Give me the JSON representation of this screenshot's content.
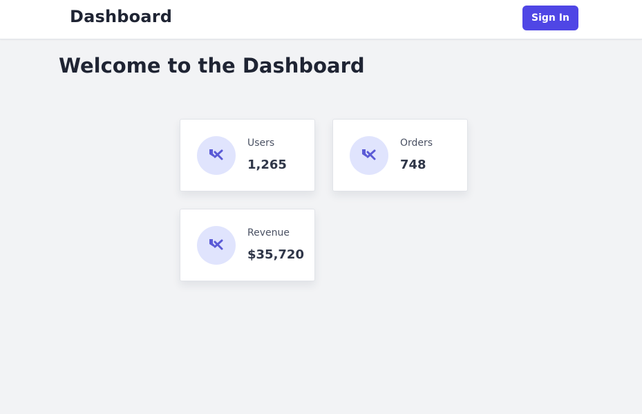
{
  "header": {
    "brand": "Dashboard",
    "sign_in_label": "Sign In"
  },
  "main": {
    "title": "Welcome to the Dashboard"
  },
  "stats": [
    {
      "label": "Users",
      "value": "1,265",
      "icon": "tools-icon"
    },
    {
      "label": "Orders",
      "value": "748",
      "icon": "tools-icon"
    },
    {
      "label": "Revenue",
      "value": "$35,720",
      "icon": "tools-icon"
    }
  ],
  "colors": {
    "accent": "#4f46e5",
    "icon_bg": "#e0e4fd",
    "page_bg": "#f2f3f5"
  }
}
